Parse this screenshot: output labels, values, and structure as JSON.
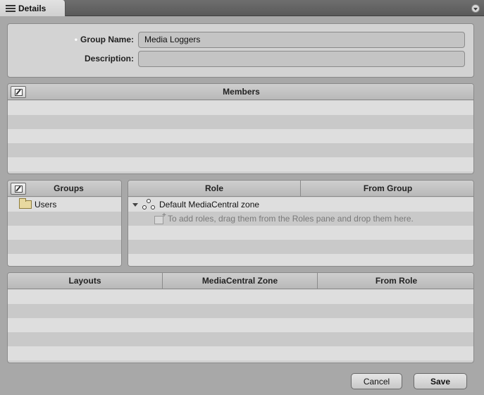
{
  "tab": {
    "label": "Details"
  },
  "form": {
    "group_name_label": "Group Name:",
    "group_name_value": "Media Loggers",
    "description_label": "Description:",
    "description_value": ""
  },
  "members": {
    "header": "Members"
  },
  "groups": {
    "header": "Groups",
    "items": [
      "Users"
    ]
  },
  "roles": {
    "columns": [
      "Role",
      "From Group"
    ],
    "zone": "Default MediaCentral zone",
    "hint": "To add roles, drag them from the Roles pane and drop them here."
  },
  "layouts": {
    "columns": [
      "Layouts",
      "MediaCentral Zone",
      "From Role"
    ]
  },
  "buttons": {
    "cancel": "Cancel",
    "save": "Save"
  }
}
